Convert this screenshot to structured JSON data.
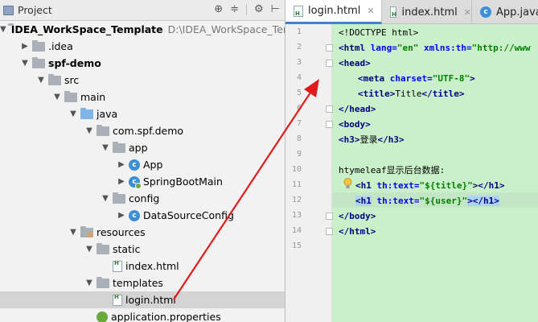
{
  "project_panel": {
    "title": "Project",
    "tools": [
      "⊕",
      "≑",
      "⚙",
      "⊢"
    ],
    "tree": [
      {
        "label": "IDEA_WorkSpace_Template",
        "path": "D:\\IDEA_WorkSpace_Tem",
        "icon": "folder",
        "arrow": "▼",
        "depth": 0,
        "bold": true
      },
      {
        "label": ".idea",
        "icon": "folder",
        "arrow": "▶",
        "depth": 1
      },
      {
        "label": "spf-demo",
        "icon": "folder",
        "arrow": "▼",
        "depth": 1,
        "bold": true
      },
      {
        "label": "src",
        "icon": "folder",
        "arrow": "▼",
        "depth": 2
      },
      {
        "label": "main",
        "icon": "folder",
        "arrow": "▼",
        "depth": 3
      },
      {
        "label": "java",
        "icon": "folder-blue",
        "arrow": "▼",
        "depth": 4
      },
      {
        "label": "com.spf.demo",
        "icon": "folder",
        "arrow": "▼",
        "depth": 5
      },
      {
        "label": "app",
        "icon": "folder",
        "arrow": "▼",
        "depth": 6
      },
      {
        "label": "App",
        "icon": "class",
        "arrow": "▶",
        "depth": 7
      },
      {
        "label": "SpringBootMain",
        "icon": "class-spring",
        "arrow": "▶",
        "depth": 7
      },
      {
        "label": "config",
        "icon": "folder",
        "arrow": "▼",
        "depth": 6
      },
      {
        "label": "DataSourceConfig",
        "icon": "class",
        "arrow": "▶",
        "depth": 7
      },
      {
        "label": "resources",
        "icon": "folder-res",
        "arrow": "▼",
        "depth": 4
      },
      {
        "label": "static",
        "icon": "folder",
        "arrow": "▼",
        "depth": 5
      },
      {
        "label": "index.html",
        "icon": "html",
        "arrow": "",
        "depth": 6
      },
      {
        "label": "templates",
        "icon": "folder",
        "arrow": "▼",
        "depth": 5
      },
      {
        "label": "login.html",
        "icon": "html",
        "arrow": "",
        "depth": 6,
        "selected": true
      },
      {
        "label": "application.properties",
        "icon": "properties",
        "arrow": "",
        "depth": 5
      }
    ]
  },
  "editor": {
    "tabs": [
      {
        "label": "login.html",
        "icon": "html",
        "active": true
      },
      {
        "label": "index.html",
        "icon": "html",
        "active": false
      },
      {
        "label": "App.java",
        "icon": "class",
        "active": false
      }
    ],
    "line_numbers": [
      "1",
      "2",
      "3",
      "4",
      "5",
      "6",
      "7",
      "8",
      "9",
      "10",
      "11",
      "12",
      "13",
      "14",
      "15"
    ],
    "code": {
      "l1": "<!DOCTYPE html>",
      "l2_tag": "<html ",
      "l2_attr1": "lang=",
      "l2_val1": "\"en\"",
      "l2_attr2": " xmlns:th=",
      "l2_val2": "\"http://www",
      "l3": "<head>",
      "l4_tag": "<meta ",
      "l4_attr": "charset=",
      "l4_val": "\"UTF-8\"",
      "l4_end": ">",
      "l5_open": "<title>",
      "l5_text": "Title",
      "l5_close": "</title>",
      "l6": "</head>",
      "l7": "<body>",
      "l8_open": "<h3>",
      "l8_text": "登录",
      "l8_close": "</h3>",
      "l10": "htymeleaf显示后台数据:",
      "l11_tag": "<h1 ",
      "l11_attr": "th:text=",
      "l11_val": "\"${title}\"",
      "l11_end": "></h1>",
      "l12_tag": "<h1",
      "l12_attr": " th:text=",
      "l12_val": "\"${user}\"",
      "l12_end": "></h1>",
      "l13": "</body>",
      "l14": "</html>"
    }
  },
  "colors": {
    "code_bg": "#c9f0c9",
    "arrow": "#e01b1b",
    "tab_active_underline": "#4083c9"
  }
}
